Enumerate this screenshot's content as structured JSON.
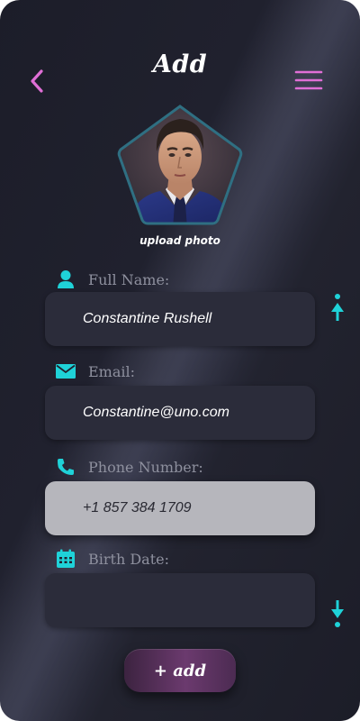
{
  "header": {
    "title": "Add",
    "back_icon": "chevron-left-icon",
    "menu_icon": "hamburger-menu-icon"
  },
  "profile": {
    "upload_label": "upload photo"
  },
  "form": {
    "full_name": {
      "label": "Full Name:",
      "value": "Constantine Rushell",
      "icon": "person-icon"
    },
    "email": {
      "label": "Email:",
      "value": "Constantine@uno.com",
      "icon": "mail-icon"
    },
    "phone": {
      "label": "Phone Number:",
      "value": "+1 857 384 1709",
      "icon": "phone-icon"
    },
    "birth_date": {
      "label": "Birth Date:",
      "value": "",
      "icon": "calendar-icon"
    }
  },
  "actions": {
    "add_label": "+ add"
  },
  "colors": {
    "background": "#1f202c",
    "accent_pink": "#e06fd6",
    "accent_cyan": "#1fd2d8",
    "field_bg": "#2b2c3a",
    "field_active_bg": "#b6b6bc",
    "label_text": "#8e909e",
    "add_button": "#6b3a6e"
  }
}
